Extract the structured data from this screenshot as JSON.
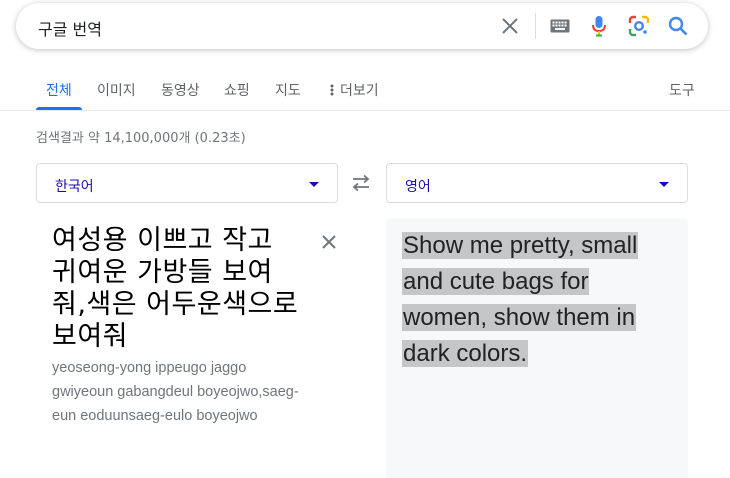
{
  "search": {
    "query": "구글 번역"
  },
  "icons": {
    "clear": "close-icon",
    "keyboard": "keyboard-icon",
    "voice": "microphone-icon",
    "lens": "google-lens-icon",
    "search": "search-icon"
  },
  "tabs": {
    "items": [
      {
        "label": "전체",
        "active": true
      },
      {
        "label": "이미지"
      },
      {
        "label": "동영상"
      },
      {
        "label": "쇼핑"
      },
      {
        "label": "지도"
      },
      {
        "label": "더보기"
      }
    ],
    "tools": "도구"
  },
  "result_stats": "검색결과 약 14,100,000개 (0.23초)",
  "translate": {
    "source_lang": "한국어",
    "target_lang": "영어",
    "source_text": "여성용 이쁘고 작고 귀여운 가방들 보여줘,색은 어두운색으로 보여줘",
    "romanization": "yeoseong-yong ippeugo jaggo gwiyeoun gabangdeul boyeojwo,saeg-eun eoduunsaeg-eulo boyeojwo",
    "target_text": "Show me pretty, small and cute bags for women, show them in dark colors."
  },
  "colors": {
    "accent": "#1a73e8",
    "link": "#1a0dab",
    "highlight": "#c5c6c8",
    "panel_bg": "#f7f8f9"
  }
}
